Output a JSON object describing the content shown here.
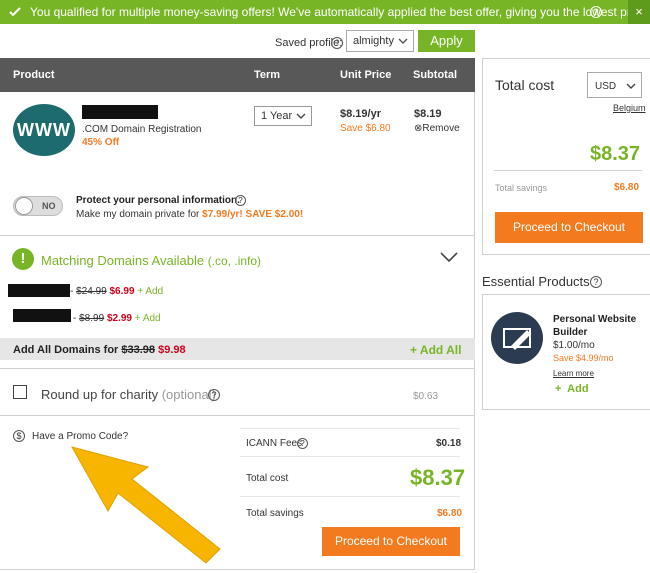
{
  "banner": {
    "message": "You qualified for multiple money-saving offers! We've automatically applied the best offer, giving you the lowest price.",
    "help": "?",
    "close": "×"
  },
  "profile": {
    "label": "Saved profile:",
    "value": "almighty",
    "apply": "Apply"
  },
  "table": {
    "headers": [
      "Product",
      "Term",
      "Unit Price",
      "Subtotal"
    ]
  },
  "item": {
    "icon_text": "WWW",
    "name": ".COM Domain Registration",
    "discount": "45% Off",
    "term": "1 Year",
    "unit_price": "$8.19/yr",
    "save": "Save $6.80",
    "subtotal": "$8.19",
    "remove": "Remove"
  },
  "privacy": {
    "toggle": "NO",
    "title": "Protect your personal information.",
    "text_prefix": "Make my domain private for",
    "offer": "$7.99/yr! SAVE $2.00!"
  },
  "matching": {
    "title": "Matching Domains Available",
    "suffix": "(.co, .info)",
    "items": [
      {
        "sep": "-",
        "old": "$24.99",
        "new": "$6.99",
        "add": "+ Add"
      },
      {
        "sep": "-",
        "old": "$8.99",
        "new": "$2.99",
        "add": "+ Add"
      }
    ],
    "add_all_prefix": "Add All Domains for",
    "add_all_old": "$33.98",
    "add_all_new": "$9.98",
    "add_all_btn": "+ Add All"
  },
  "charity": {
    "label": "Round up for charity",
    "optional": "(optional)",
    "amount": "$0.63"
  },
  "promo": {
    "label": "Have a Promo Code?"
  },
  "summary": {
    "icann_label": "ICANN Fees",
    "icann_value": "$0.18",
    "total_label": "Total cost",
    "total_value": "$8.37",
    "savings_label": "Total savings",
    "savings_value": "$6.80",
    "checkout": "Proceed to Checkout"
  },
  "sidebar": {
    "total_label": "Total cost",
    "currency": "USD",
    "region": "Belgium",
    "total_value": "$8.37",
    "savings_label": "Total savings",
    "savings_value": "$6.80",
    "checkout": "Proceed to Checkout"
  },
  "essential": {
    "title": "Essential Products",
    "product": {
      "name": "Personal Website Builder",
      "price": "$1.00/mo",
      "save": "Save $4.99/mo",
      "learn": "Learn more",
      "add": "Add"
    }
  },
  "colors": {
    "green": "#78b526",
    "orange": "#f47a20",
    "red": "#d0021b",
    "header": "#585858"
  }
}
